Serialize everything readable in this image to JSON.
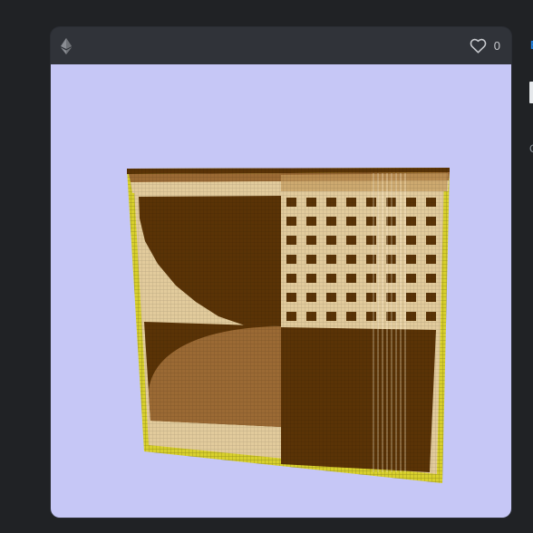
{
  "card": {
    "chain_icon": "ethereum-icon",
    "favorite_icon": "heart-outline-icon",
    "favorite_count": "0",
    "background_color": "#c6c7f6",
    "artwork_colors": {
      "dark_brown": "#5a3306",
      "mid_brown": "#9b6a34",
      "tan": "#e2cb9c",
      "frame_yellow": "#d8d02c"
    }
  },
  "right_panel": {
    "link_text": "E",
    "title_text": "",
    "subtitle_text": "C"
  }
}
